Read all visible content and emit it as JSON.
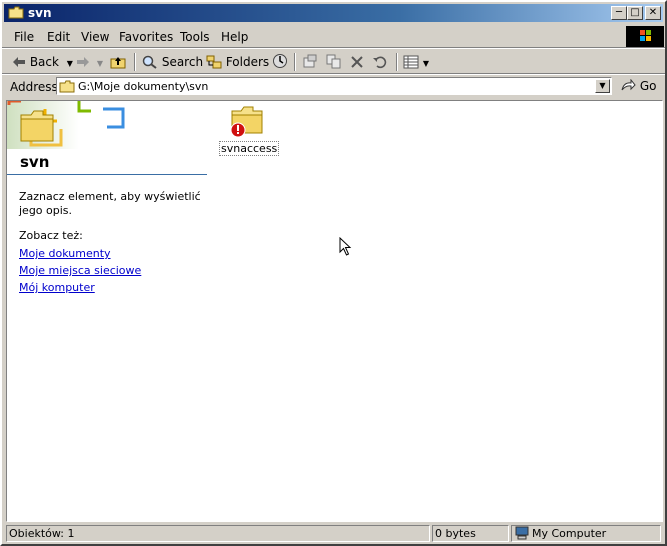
{
  "window": {
    "title": "svn"
  },
  "menu": [
    "File",
    "Edit",
    "View",
    "Favorites",
    "Tools",
    "Help"
  ],
  "toolbar": {
    "back": "Back",
    "search": "Search",
    "folders": "Folders"
  },
  "address": {
    "label": "Address",
    "value": "G:\\Moje dokumenty\\svn",
    "go": "Go"
  },
  "panel": {
    "title": "svn",
    "description": "Zaznacz element, aby wyświetlić jego opis.",
    "see_also": "Zobacz też:",
    "links": [
      "Moje dokumenty",
      "Moje miejsca sieciowe",
      "Mój komputer"
    ]
  },
  "items": [
    {
      "name": "svnaccess",
      "icon": "folder-error-icon"
    }
  ],
  "status": {
    "objects": "Obiektów: 1",
    "size": "0 bytes",
    "zone": "My Computer"
  }
}
